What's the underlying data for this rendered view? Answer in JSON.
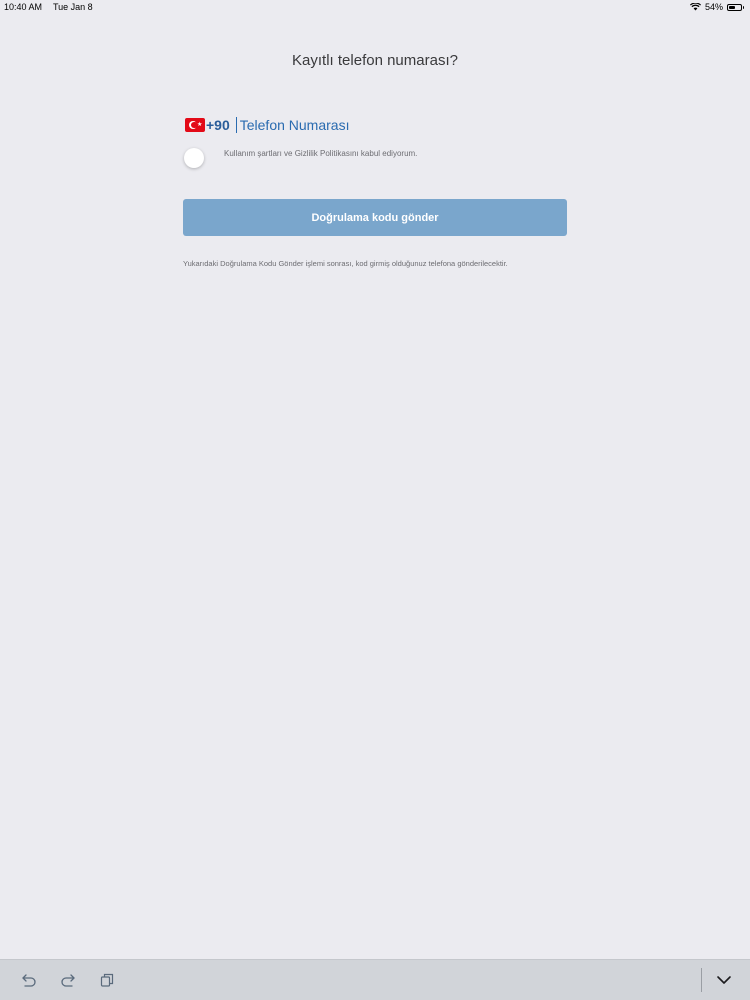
{
  "status_bar": {
    "time": "10:40 AM",
    "date": "Tue Jan 8",
    "battery_percent_text": "54%",
    "battery_level": 0.54
  },
  "page": {
    "title": "Kayıtlı telefon numarası?"
  },
  "phone": {
    "country_code": "+90",
    "placeholder": "Telefon Numarası",
    "value": "",
    "flag_icon": "turkey-flag-icon"
  },
  "terms": {
    "label": "Kullanım şartları ve Gizlilik Politikasını kabul ediyorum.",
    "checked": false
  },
  "send_button": {
    "label": "Doğrulama kodu gönder"
  },
  "info": {
    "text": "Yukarıdaki Doğrulama Kodu Gönder işlemi sonrası, kod girmiş olduğunuz telefona gönderilecektir."
  },
  "toolbar": {
    "undo_icon": "undo-icon",
    "redo_icon": "redo-icon",
    "copy_icon": "copy-icon",
    "dismiss_icon": "chevron-down-icon"
  },
  "colors": {
    "background": "#ebebf0",
    "button": "#7aa6cc",
    "accent": "#2a6bb0"
  }
}
